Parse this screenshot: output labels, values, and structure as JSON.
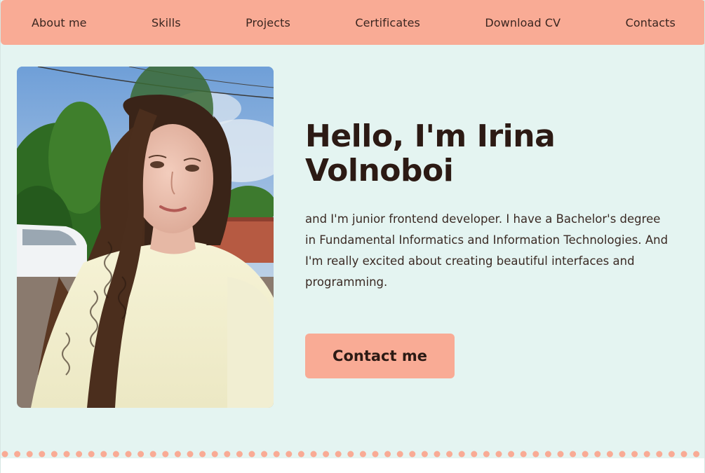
{
  "nav": {
    "items": [
      {
        "label": "About me"
      },
      {
        "label": "Skills"
      },
      {
        "label": "Projects"
      },
      {
        "label": "Certificates"
      },
      {
        "label": "Download CV"
      },
      {
        "label": "Contacts"
      }
    ]
  },
  "hero": {
    "title": "Hello, I'm Irina Volnoboi",
    "description": "and I'm junior frontend developer. I have a Bachelor's degree in Fundamental Informatics and Information Technologies. And I'm really excited about creating beautiful interfaces and programming.",
    "button_label": "Contact me"
  },
  "colors": {
    "accent": "#f9ab95",
    "background": "#e4f4f1",
    "text": "#2c1a14"
  }
}
